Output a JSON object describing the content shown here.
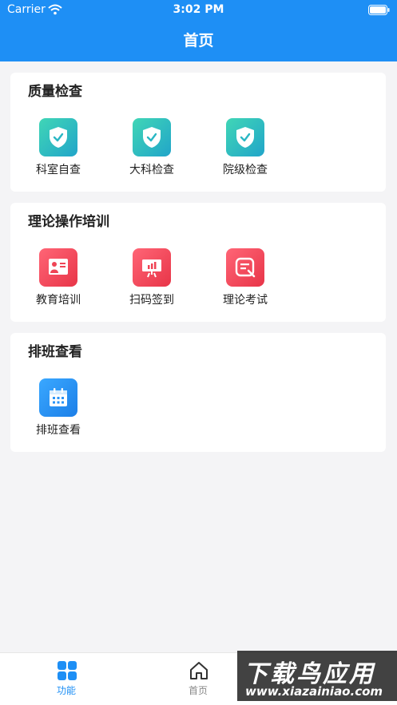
{
  "status_bar": {
    "carrier": "Carrier",
    "time": "3:02 PM"
  },
  "nav": {
    "title": "首页"
  },
  "colors": {
    "primary": "#1e8ff5",
    "teal": "#2ec4bd",
    "red": "#f0475a",
    "blue": "#2a94f7"
  },
  "sections": [
    {
      "title": "质量检查",
      "items": [
        {
          "label": "科室自查",
          "icon": "shield-check-icon"
        },
        {
          "label": "大科检查",
          "icon": "shield-check-icon"
        },
        {
          "label": "院级检查",
          "icon": "shield-check-icon"
        }
      ]
    },
    {
      "title": "理论操作培训",
      "items": [
        {
          "label": "教育培训",
          "icon": "teacher-board-icon"
        },
        {
          "label": "扫码签到",
          "icon": "presentation-chart-icon"
        },
        {
          "label": "理论考试",
          "icon": "exam-paper-icon"
        }
      ]
    },
    {
      "title": "排班查看",
      "items": [
        {
          "label": "排班查看",
          "icon": "calendar-icon"
        }
      ]
    }
  ],
  "tabbar": {
    "items": [
      {
        "label": "功能",
        "icon": "grid-icon",
        "active": true
      },
      {
        "label": "首页",
        "icon": "home-icon",
        "active": false
      }
    ]
  },
  "watermark": {
    "title": "下载鸟应用",
    "url": "www.xiazainiao.com"
  }
}
